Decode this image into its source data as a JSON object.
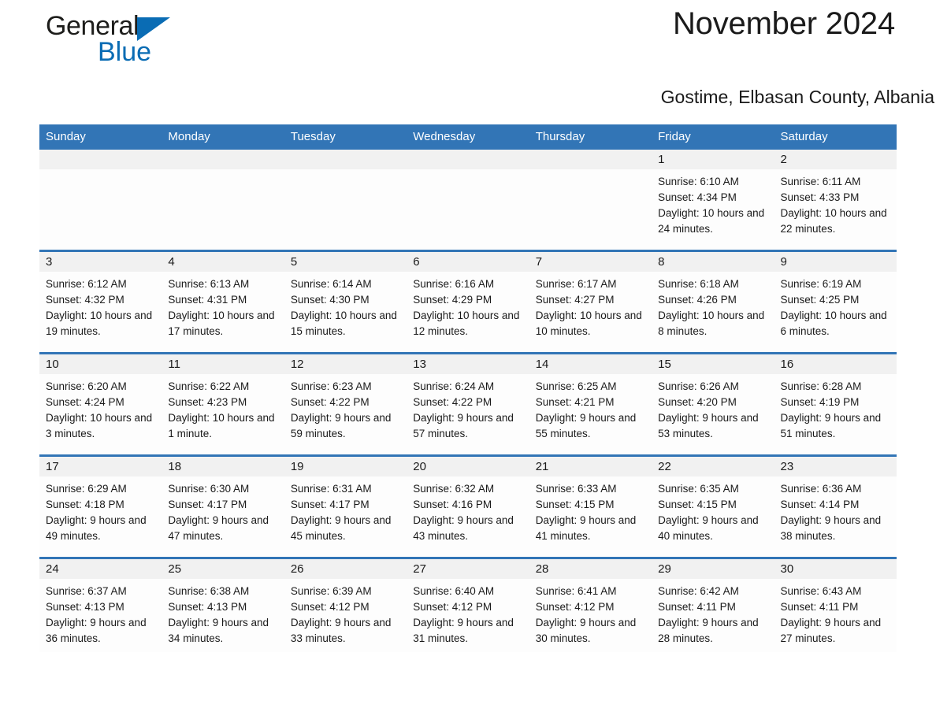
{
  "brand": {
    "name_part1": "General",
    "name_part2": "Blue",
    "accent_color": "#0a6cb4"
  },
  "header": {
    "month_title": "November 2024",
    "location": "Gostime, Elbasan County, Albania",
    "header_bg_color": "#3275b6",
    "daynum_band_color": "#f1f1f1"
  },
  "weekday_headers": [
    "Sunday",
    "Monday",
    "Tuesday",
    "Wednesday",
    "Thursday",
    "Friday",
    "Saturday"
  ],
  "weeks": [
    [
      {
        "day": "",
        "sunrise": "",
        "sunset": "",
        "daylight": ""
      },
      {
        "day": "",
        "sunrise": "",
        "sunset": "",
        "daylight": ""
      },
      {
        "day": "",
        "sunrise": "",
        "sunset": "",
        "daylight": ""
      },
      {
        "day": "",
        "sunrise": "",
        "sunset": "",
        "daylight": ""
      },
      {
        "day": "",
        "sunrise": "",
        "sunset": "",
        "daylight": ""
      },
      {
        "day": "1",
        "sunrise": "Sunrise: 6:10 AM",
        "sunset": "Sunset: 4:34 PM",
        "daylight": "Daylight: 10 hours and 24 minutes."
      },
      {
        "day": "2",
        "sunrise": "Sunrise: 6:11 AM",
        "sunset": "Sunset: 4:33 PM",
        "daylight": "Daylight: 10 hours and 22 minutes."
      }
    ],
    [
      {
        "day": "3",
        "sunrise": "Sunrise: 6:12 AM",
        "sunset": "Sunset: 4:32 PM",
        "daylight": "Daylight: 10 hours and 19 minutes."
      },
      {
        "day": "4",
        "sunrise": "Sunrise: 6:13 AM",
        "sunset": "Sunset: 4:31 PM",
        "daylight": "Daylight: 10 hours and 17 minutes."
      },
      {
        "day": "5",
        "sunrise": "Sunrise: 6:14 AM",
        "sunset": "Sunset: 4:30 PM",
        "daylight": "Daylight: 10 hours and 15 minutes."
      },
      {
        "day": "6",
        "sunrise": "Sunrise: 6:16 AM",
        "sunset": "Sunset: 4:29 PM",
        "daylight": "Daylight: 10 hours and 12 minutes."
      },
      {
        "day": "7",
        "sunrise": "Sunrise: 6:17 AM",
        "sunset": "Sunset: 4:27 PM",
        "daylight": "Daylight: 10 hours and 10 minutes."
      },
      {
        "day": "8",
        "sunrise": "Sunrise: 6:18 AM",
        "sunset": "Sunset: 4:26 PM",
        "daylight": "Daylight: 10 hours and 8 minutes."
      },
      {
        "day": "9",
        "sunrise": "Sunrise: 6:19 AM",
        "sunset": "Sunset: 4:25 PM",
        "daylight": "Daylight: 10 hours and 6 minutes."
      }
    ],
    [
      {
        "day": "10",
        "sunrise": "Sunrise: 6:20 AM",
        "sunset": "Sunset: 4:24 PM",
        "daylight": "Daylight: 10 hours and 3 minutes."
      },
      {
        "day": "11",
        "sunrise": "Sunrise: 6:22 AM",
        "sunset": "Sunset: 4:23 PM",
        "daylight": "Daylight: 10 hours and 1 minute."
      },
      {
        "day": "12",
        "sunrise": "Sunrise: 6:23 AM",
        "sunset": "Sunset: 4:22 PM",
        "daylight": "Daylight: 9 hours and 59 minutes."
      },
      {
        "day": "13",
        "sunrise": "Sunrise: 6:24 AM",
        "sunset": "Sunset: 4:22 PM",
        "daylight": "Daylight: 9 hours and 57 minutes."
      },
      {
        "day": "14",
        "sunrise": "Sunrise: 6:25 AM",
        "sunset": "Sunset: 4:21 PM",
        "daylight": "Daylight: 9 hours and 55 minutes."
      },
      {
        "day": "15",
        "sunrise": "Sunrise: 6:26 AM",
        "sunset": "Sunset: 4:20 PM",
        "daylight": "Daylight: 9 hours and 53 minutes."
      },
      {
        "day": "16",
        "sunrise": "Sunrise: 6:28 AM",
        "sunset": "Sunset: 4:19 PM",
        "daylight": "Daylight: 9 hours and 51 minutes."
      }
    ],
    [
      {
        "day": "17",
        "sunrise": "Sunrise: 6:29 AM",
        "sunset": "Sunset: 4:18 PM",
        "daylight": "Daylight: 9 hours and 49 minutes."
      },
      {
        "day": "18",
        "sunrise": "Sunrise: 6:30 AM",
        "sunset": "Sunset: 4:17 PM",
        "daylight": "Daylight: 9 hours and 47 minutes."
      },
      {
        "day": "19",
        "sunrise": "Sunrise: 6:31 AM",
        "sunset": "Sunset: 4:17 PM",
        "daylight": "Daylight: 9 hours and 45 minutes."
      },
      {
        "day": "20",
        "sunrise": "Sunrise: 6:32 AM",
        "sunset": "Sunset: 4:16 PM",
        "daylight": "Daylight: 9 hours and 43 minutes."
      },
      {
        "day": "21",
        "sunrise": "Sunrise: 6:33 AM",
        "sunset": "Sunset: 4:15 PM",
        "daylight": "Daylight: 9 hours and 41 minutes."
      },
      {
        "day": "22",
        "sunrise": "Sunrise: 6:35 AM",
        "sunset": "Sunset: 4:15 PM",
        "daylight": "Daylight: 9 hours and 40 minutes."
      },
      {
        "day": "23",
        "sunrise": "Sunrise: 6:36 AM",
        "sunset": "Sunset: 4:14 PM",
        "daylight": "Daylight: 9 hours and 38 minutes."
      }
    ],
    [
      {
        "day": "24",
        "sunrise": "Sunrise: 6:37 AM",
        "sunset": "Sunset: 4:13 PM",
        "daylight": "Daylight: 9 hours and 36 minutes."
      },
      {
        "day": "25",
        "sunrise": "Sunrise: 6:38 AM",
        "sunset": "Sunset: 4:13 PM",
        "daylight": "Daylight: 9 hours and 34 minutes."
      },
      {
        "day": "26",
        "sunrise": "Sunrise: 6:39 AM",
        "sunset": "Sunset: 4:12 PM",
        "daylight": "Daylight: 9 hours and 33 minutes."
      },
      {
        "day": "27",
        "sunrise": "Sunrise: 6:40 AM",
        "sunset": "Sunset: 4:12 PM",
        "daylight": "Daylight: 9 hours and 31 minutes."
      },
      {
        "day": "28",
        "sunrise": "Sunrise: 6:41 AM",
        "sunset": "Sunset: 4:12 PM",
        "daylight": "Daylight: 9 hours and 30 minutes."
      },
      {
        "day": "29",
        "sunrise": "Sunrise: 6:42 AM",
        "sunset": "Sunset: 4:11 PM",
        "daylight": "Daylight: 9 hours and 28 minutes."
      },
      {
        "day": "30",
        "sunrise": "Sunrise: 6:43 AM",
        "sunset": "Sunset: 4:11 PM",
        "daylight": "Daylight: 9 hours and 27 minutes."
      }
    ]
  ]
}
